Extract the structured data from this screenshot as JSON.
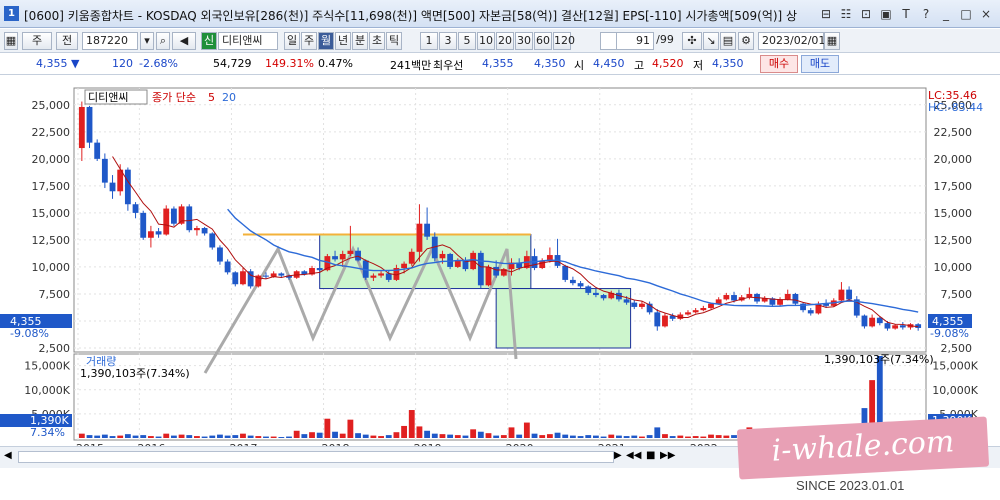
{
  "titlebar": {
    "app_icon": "1",
    "title": "[0600] 키움종합차트 - KOSDAQ 외국인보유[286(천)] 주식수[11,698(천)] 액면[500] 자본금[58(억)] 결산[12월] EPS[-110] 시가총액[509(억)] 상"
  },
  "toolbar": {
    "period_select": "주",
    "market_select": "전",
    "code_value": "187220",
    "credit_badge": "신",
    "stock_name": "디티앤씨",
    "timeframes": [
      "일",
      "주",
      "월",
      "년",
      "분",
      "초",
      "틱"
    ],
    "timeframe_active": "월",
    "intervals": [
      "1",
      "3",
      "5",
      "10",
      "20",
      "30",
      "60",
      "120"
    ],
    "page_value": "91",
    "page_total": "/99",
    "date_value": "2023/02/01"
  },
  "infobar": {
    "price": "4,355",
    "direction_icon": "down-triangle-icon",
    "change": "120",
    "change_pct": "-2.68%",
    "volume": "54,729",
    "volume_ratio": "149.31%",
    "turnover": "0.47%",
    "amount": "241백만",
    "best_label": "최우선",
    "best_ask": "4,355",
    "best_bid": "4,350",
    "open_label": "시",
    "open": "4,450",
    "high_label": "고",
    "high": "4,520",
    "low_label": "저",
    "low": "4,350",
    "buy_label": "매수",
    "sell_label": "매도"
  },
  "legend": {
    "stock_name": "디티앤씨",
    "ma_label": "종가 단순",
    "ma_short": "5",
    "ma_long": "20",
    "lc": "LC:35.46",
    "hc": "HC:-83.44",
    "volume_title": "거래량",
    "volume_peak_left": "1,390,103주(7.34%)",
    "volume_peak_right": "1,390,103주(7.34%)"
  },
  "price_axis": {
    "ticks": [
      "25,000",
      "22,500",
      "20,000",
      "17,500",
      "15,000",
      "12,500",
      "10,000",
      "7,500",
      "5,000",
      "2,500"
    ],
    "current": "4,355",
    "current_pct": "-9.08%"
  },
  "volume_axis": {
    "ticks": [
      "15,000K",
      "10,000K",
      "5,000K"
    ],
    "current": "1,390K",
    "current_pct": "7.34%"
  },
  "x_axis": {
    "years": [
      "2015",
      "2016",
      "2017",
      "2018",
      "2019",
      "2020",
      "2021",
      "2022"
    ]
  },
  "watermark": {
    "text": "i-whale.com",
    "since": "SINCE 2023.01.01"
  },
  "colors": {
    "up": "#e02020",
    "down": "#1f58c8",
    "ma5": "#b01010",
    "ma20": "#2d6bd8",
    "box_fill": "#cdf5cd",
    "box_border": "#1a2f9a",
    "resistance": "#f3b23a"
  },
  "chart_data": {
    "type": "candlestick",
    "price_ylim": [
      2500,
      26000
    ],
    "volume_ylim": [
      0,
      17000
    ],
    "current_price": 4355,
    "resistance_price": 13000,
    "candles": [
      [
        21000,
        25300,
        19800,
        24800
      ],
      [
        24800,
        24900,
        21000,
        21500
      ],
      [
        21500,
        21800,
        19800,
        20000
      ],
      [
        20000,
        20500,
        17300,
        17800
      ],
      [
        17800,
        18500,
        16300,
        17000
      ],
      [
        17000,
        19500,
        16600,
        19000
      ],
      [
        19000,
        19200,
        15200,
        15800
      ],
      [
        15800,
        16000,
        14500,
        15000
      ],
      [
        15000,
        15200,
        12500,
        12700
      ],
      [
        12700,
        13800,
        11800,
        13300
      ],
      [
        13300,
        13600,
        12700,
        13000
      ],
      [
        13000,
        15700,
        12900,
        15400
      ],
      [
        15400,
        15600,
        13800,
        14000
      ],
      [
        14000,
        15800,
        13900,
        15600
      ],
      [
        15600,
        15800,
        13200,
        13400
      ],
      [
        13400,
        13800,
        12900,
        13600
      ],
      [
        13600,
        13700,
        12900,
        13100
      ],
      [
        13100,
        13200,
        11600,
        11800
      ],
      [
        11800,
        12000,
        10200,
        10500
      ],
      [
        10500,
        10700,
        9300,
        9500
      ],
      [
        9500,
        9600,
        8200,
        8400
      ],
      [
        8400,
        9900,
        8300,
        9600
      ],
      [
        9600,
        9800,
        8000,
        8200
      ],
      [
        8200,
        9300,
        8100,
        9200
      ],
      [
        9200,
        9500,
        8900,
        9100
      ],
      [
        9100,
        9600,
        9000,
        9400
      ],
      [
        9400,
        9500,
        9000,
        9200
      ],
      [
        9200,
        9300,
        8800,
        9000
      ],
      [
        9000,
        9700,
        8900,
        9600
      ],
      [
        9600,
        9700,
        9200,
        9300
      ],
      [
        9300,
        10100,
        9200,
        9900
      ],
      [
        9900,
        10500,
        9600,
        9700
      ],
      [
        9700,
        11200,
        9600,
        11000
      ],
      [
        11000,
        11500,
        10500,
        10700
      ],
      [
        10700,
        11500,
        10000,
        11200
      ],
      [
        11200,
        13800,
        11000,
        11500
      ],
      [
        11500,
        11800,
        10500,
        10600
      ],
      [
        10600,
        10700,
        8800,
        9000
      ],
      [
        9000,
        9400,
        8700,
        9200
      ],
      [
        9200,
        9600,
        9000,
        9400
      ],
      [
        9400,
        9700,
        8600,
        8800
      ],
      [
        8800,
        10200,
        8700,
        9900
      ],
      [
        9900,
        10500,
        9400,
        10300
      ],
      [
        10300,
        11700,
        10100,
        11400
      ],
      [
        11400,
        15800,
        10500,
        14000
      ],
      [
        14000,
        15500,
        12500,
        12800
      ],
      [
        12800,
        13200,
        10500,
        10800
      ],
      [
        10800,
        11500,
        10300,
        11200
      ],
      [
        11200,
        11300,
        9800,
        10000
      ],
      [
        10000,
        10800,
        9900,
        10600
      ],
      [
        10600,
        10900,
        9600,
        9800
      ],
      [
        9800,
        11500,
        9700,
        11300
      ],
      [
        11300,
        11500,
        8000,
        8300
      ],
      [
        8300,
        10200,
        8200,
        10000
      ],
      [
        10000,
        10600,
        9000,
        9200
      ],
      [
        9200,
        9900,
        9100,
        9800
      ],
      [
        9800,
        10800,
        9200,
        10400
      ],
      [
        10400,
        10800,
        9700,
        9900
      ],
      [
        9900,
        11500,
        9800,
        11000
      ],
      [
        11000,
        11700,
        9700,
        9900
      ],
      [
        9900,
        10800,
        9800,
        10600
      ],
      [
        10600,
        11800,
        10400,
        11100
      ],
      [
        11100,
        12600,
        9900,
        10100
      ],
      [
        10100,
        10200,
        8600,
        8800
      ],
      [
        8800,
        9100,
        8300,
        8500
      ],
      [
        8500,
        8700,
        8000,
        8200
      ],
      [
        8200,
        8300,
        7400,
        7600
      ],
      [
        7600,
        8000,
        7200,
        7400
      ],
      [
        7400,
        7500,
        6900,
        7100
      ],
      [
        7100,
        7800,
        7000,
        7600
      ],
      [
        7600,
        7900,
        6800,
        7000
      ],
      [
        7000,
        7300,
        6500,
        6700
      ],
      [
        6700,
        6900,
        6100,
        6300
      ],
      [
        6300,
        6800,
        6100,
        6600
      ],
      [
        6600,
        6800,
        5600,
        5800
      ],
      [
        5800,
        6100,
        4100,
        4500
      ],
      [
        4500,
        5700,
        4400,
        5500
      ],
      [
        5500,
        5700,
        5000,
        5200
      ],
      [
        5200,
        5800,
        5100,
        5600
      ],
      [
        5600,
        6000,
        5500,
        5800
      ],
      [
        5800,
        6200,
        5700,
        6000
      ],
      [
        6000,
        6400,
        5900,
        6200
      ],
      [
        6200,
        6700,
        6100,
        6600
      ],
      [
        6600,
        7200,
        6500,
        7000
      ],
      [
        7000,
        7600,
        6900,
        7400
      ],
      [
        7400,
        7700,
        6700,
        6900
      ],
      [
        6900,
        7400,
        6800,
        7200
      ],
      [
        7200,
        8100,
        7000,
        7500
      ],
      [
        7500,
        7600,
        6600,
        6800
      ],
      [
        6800,
        7300,
        6700,
        7100
      ],
      [
        7100,
        7200,
        6300,
        6500
      ],
      [
        6500,
        7200,
        6400,
        7000
      ],
      [
        7000,
        7900,
        6900,
        7500
      ],
      [
        7500,
        7600,
        6400,
        6600
      ],
      [
        6600,
        6700,
        5800,
        6000
      ],
      [
        6000,
        6200,
        5500,
        5700
      ],
      [
        5700,
        6800,
        5600,
        6600
      ],
      [
        6600,
        7000,
        6200,
        6400
      ],
      [
        6400,
        7100,
        6300,
        6900
      ],
      [
        6900,
        8600,
        6800,
        7900
      ],
      [
        7900,
        8200,
        6800,
        7000
      ],
      [
        7000,
        7300,
        5300,
        5500
      ],
      [
        5500,
        5600,
        4300,
        4500
      ],
      [
        4500,
        5600,
        4400,
        5300
      ],
      [
        5300,
        5400,
        4600,
        4800
      ],
      [
        4800,
        5000,
        4100,
        4300
      ],
      [
        4300,
        4700,
        4200,
        4600
      ],
      [
        4600,
        4900,
        4200,
        4400
      ],
      [
        4400,
        4800,
        4200,
        4700
      ],
      [
        4700,
        4800,
        4100,
        4355
      ]
    ],
    "volume": [
      900,
      600,
      500,
      700,
      400,
      500,
      800,
      500,
      600,
      400,
      300,
      900,
      500,
      700,
      600,
      400,
      300,
      500,
      700,
      500,
      600,
      900,
      500,
      400,
      300,
      300,
      200,
      300,
      1500,
      800,
      1200,
      1100,
      4000,
      1300,
      900,
      3800,
      1000,
      700,
      500,
      400,
      600,
      1200,
      2500,
      5800,
      2400,
      1500,
      900,
      800,
      700,
      600,
      500,
      1800,
      1300,
      1000,
      500,
      600,
      2200,
      700,
      3200,
      900,
      600,
      800,
      1100,
      700,
      500,
      400,
      600,
      500,
      300,
      700,
      500,
      400,
      500,
      300,
      600,
      2200,
      800,
      400,
      500,
      300,
      400,
      300,
      700,
      600,
      500,
      600,
      300,
      2200,
      600,
      500,
      400,
      300,
      400,
      500,
      300,
      900,
      500,
      300,
      1200,
      1000,
      2500,
      1200,
      6200,
      12000,
      17000,
      2000,
      1390
    ]
  }
}
